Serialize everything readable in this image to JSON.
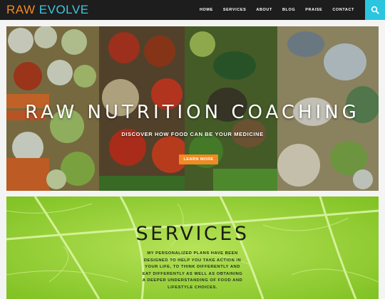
{
  "brand": {
    "part1": "RAW",
    "part2": "EVOLVE"
  },
  "nav": {
    "items": [
      "HOME",
      "SERVICES",
      "ABOUT",
      "BLOG",
      "PRAISE",
      "CONTACT"
    ],
    "search_icon": "search-icon"
  },
  "hero": {
    "title": "RAW  NUTRITION  COACHING",
    "subtitle": "DISCOVER HOW FOOD CAN BE YOUR MEDICINE",
    "button": "LEARN MORE"
  },
  "services": {
    "title": "SERVICES",
    "text": "MY PERSONALIZED PLANS HAVE BEEN DESIGNED TO HELP YOU TAKE ACTION IN YOUR LIFE, TO THINK DIFFERENTLY AND EAT DIFFERENTLY AS WELL AS OBTAINING A DEEPER UNDERSTANDING OF FOOD AND LIFESTYLE CHOICES."
  },
  "colors": {
    "brand_orange": "#f08a24",
    "brand_cyan": "#3fc7e0",
    "navbar": "#1d1d1d",
    "leaf_green": "#9ed43a"
  }
}
